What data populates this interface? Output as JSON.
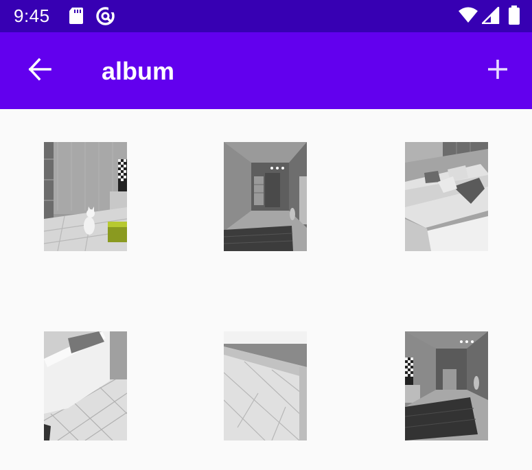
{
  "status_bar": {
    "time": "9:45",
    "icons": [
      "sd-card-icon",
      "data-saver-icon",
      "wifi-icon",
      "signal-icon",
      "battery-icon"
    ]
  },
  "app_bar": {
    "title": "album",
    "back_icon": "arrow-back-icon",
    "add_icon": "add-icon"
  },
  "colors": {
    "status_bar": "#3700b3",
    "app_bar": "#6200ee",
    "background": "#fafafa"
  },
  "album": {
    "photos": [
      {
        "scene": "living-room-with-white-cat-and-shelves"
      },
      {
        "scene": "hallway-with-dark-rug"
      },
      {
        "scene": "white-sofa-with-cushions"
      },
      {
        "scene": "sofa-arm-on-tiled-floor"
      },
      {
        "scene": "window-sill-and-tiled-floor"
      },
      {
        "scene": "hallway-with-rug-and-checkered-art"
      }
    ]
  }
}
